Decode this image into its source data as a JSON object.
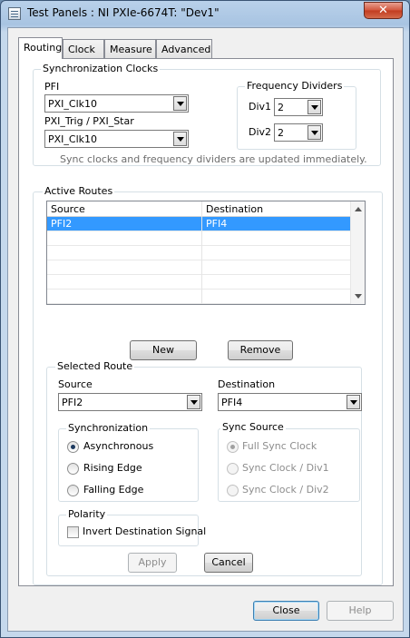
{
  "window": {
    "title": "Test Panels : NI PXIe-6674T: \"Dev1\"",
    "close_glyph": "✕",
    "icon": "test-panel-app-icon"
  },
  "tabs": [
    {
      "label": "Routing",
      "active": true
    },
    {
      "label": "Clock",
      "active": false
    },
    {
      "label": "Measure",
      "active": false
    },
    {
      "label": "Advanced",
      "active": false
    }
  ],
  "sync_clocks": {
    "title": "Synchronization Clocks",
    "pfi_label": "PFI",
    "pfi_value": "PXI_Clk10",
    "trig_label": "PXI_Trig / PXI_Star",
    "trig_value": "PXI_Clk10",
    "freq_dividers": {
      "title": "Frequency Dividers",
      "div1_label": "Div1",
      "div1_value": "2",
      "div2_label": "Div2",
      "div2_value": "2"
    },
    "note": "Sync clocks and frequency dividers are updated immediately."
  },
  "active_routes": {
    "title": "Active Routes",
    "columns": [
      "Source",
      "Destination"
    ],
    "rows": [
      {
        "source": "PFI2",
        "destination": "PFI4",
        "selected": true
      }
    ],
    "empty_rows": 5,
    "new_label": "New",
    "remove_label": "Remove"
  },
  "selected_route": {
    "title": "Selected Route",
    "source_label": "Source",
    "source_value": "PFI2",
    "destination_label": "Destination",
    "destination_value": "PFI4",
    "synchronization": {
      "title": "Synchronization",
      "options": [
        {
          "label": "Asynchronous",
          "checked": true
        },
        {
          "label": "Rising Edge",
          "checked": false
        },
        {
          "label": "Falling Edge",
          "checked": false
        }
      ]
    },
    "sync_source": {
      "title": "Sync Source",
      "disabled": true,
      "options": [
        {
          "label": "Full Sync Clock",
          "checked": true
        },
        {
          "label": "Sync Clock / Div1",
          "checked": false
        },
        {
          "label": "Sync Clock / Div2",
          "checked": false
        }
      ]
    },
    "polarity": {
      "title": "Polarity",
      "invert_label": "Invert Destination Signal",
      "invert_checked": false
    },
    "apply_label": "Apply",
    "cancel_label": "Cancel"
  },
  "footer": {
    "close_label": "Close",
    "help_label": "Help"
  },
  "colors": {
    "selection": "#3399ff",
    "title_bar": "#b9d1ea",
    "close_button": "#c13b1f"
  }
}
